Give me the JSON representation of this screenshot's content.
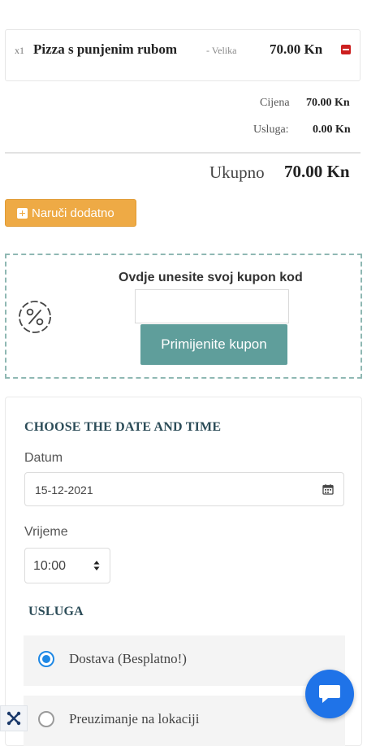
{
  "cart": {
    "item": {
      "qty": "x1",
      "name": "Pizza s punjenim rubom",
      "size": "- Velika",
      "price": "70.00 Kn"
    },
    "subtotal_label": "Cijena",
    "subtotal_value": "70.00 Kn",
    "service_label": "Usluga:",
    "service_value": "0.00 Kn",
    "total_label": "Ukupno",
    "total_value": "70.00 Kn",
    "order_more_label": "Naruči dodatno"
  },
  "coupon": {
    "title": "Ovdje unesite svoj kupon kod",
    "input_value": "",
    "apply_label": "Primijenite kupon"
  },
  "schedule": {
    "title": "CHOOSE THE DATE AND TIME",
    "date_label": "Datum",
    "date_value": "15-12-2021",
    "time_label": "Vrijeme",
    "time_value": "10:00"
  },
  "service": {
    "title": "USLUGA",
    "options": [
      {
        "label": "Dostava (Besplatno!)",
        "selected": true
      },
      {
        "label": "Preuzimanje na lokaciji",
        "selected": false
      }
    ]
  },
  "colors": {
    "accent_orange": "#eeaa45",
    "coupon_teal": "#5f9e9b",
    "heading_teal": "#2c4c58",
    "radio_blue": "#1e88e5",
    "chat_blue": "#1f73e8",
    "remove_red": "#cc1f1f"
  },
  "icons": {
    "remove": "minus-box-icon",
    "add": "plus-box-icon",
    "coupon": "percent-badge-icon",
    "calendar": "calendar-icon",
    "select": "up-down-arrows-icon",
    "chat": "chat-bubble-icon",
    "cms": "joomla-logo-icon"
  }
}
